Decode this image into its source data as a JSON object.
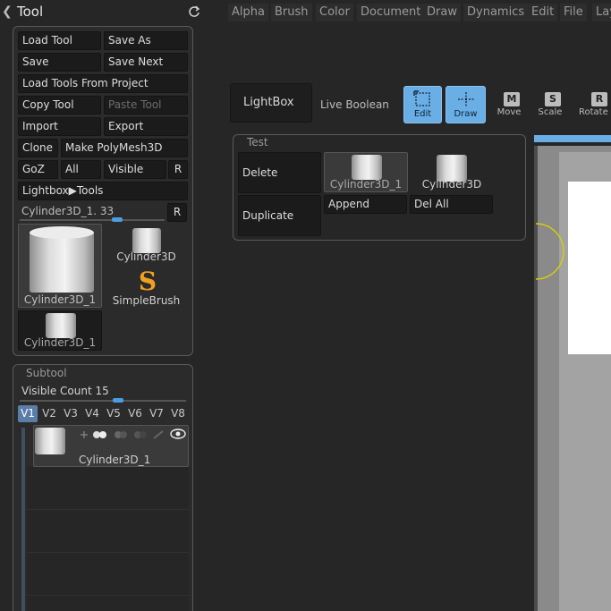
{
  "tool_panel": {
    "title": "Tool",
    "buttons": {
      "load_tool": "Load Tool",
      "save_as": "Save As",
      "save": "Save",
      "save_next": "Save Next",
      "load_tools_from_project": "Load Tools From Project",
      "copy_tool": "Copy Tool",
      "paste_tool": "Paste Tool",
      "import": "Import",
      "export": "Export",
      "clone": "Clone",
      "make_polymesh": "Make PolyMesh3D",
      "goz": "GoZ",
      "all": "All",
      "visible": "Visible",
      "r": "R",
      "lightbox_tools": "Lightbox▶Tools"
    },
    "slider": {
      "label": "Cylinder3D_1. 33",
      "r": "R",
      "value_fraction": 0.33
    },
    "thumbnails": {
      "main": "Cylinder3D_1",
      "cylinder3d": "Cylinder3D",
      "simplebrush": "SimpleBrush",
      "small": "Cylinder3D_1",
      "simplebrush_glyph": "S"
    }
  },
  "subtool_panel": {
    "title": "Subtool",
    "visible_count_label": "Visible Count 15",
    "visible_count_value": 15,
    "tabs": [
      "V1",
      "V2",
      "V3",
      "V4",
      "V5",
      "V6",
      "V7",
      "V8"
    ],
    "selected_tab": "V1",
    "item_name": "Cylinder3D_1"
  },
  "menu": [
    "Alpha",
    "Brush",
    "Color",
    "Document",
    "Draw",
    "Dynamics",
    "Edit",
    "File",
    "Lay"
  ],
  "toolbar": {
    "lightbox": "LightBox",
    "live_boolean": "Live Boolean",
    "edit": "Edit",
    "draw": "Draw",
    "move": "Move",
    "scale": "Scale",
    "rotate": "Rotate",
    "move_key": "M",
    "scale_key": "S",
    "rotate_key": "R"
  },
  "test_panel": {
    "title": "Test",
    "delete": "Delete",
    "duplicate": "Duplicate",
    "append": "Append",
    "del_all": "Del All",
    "thumb1": "Cylinder3D_1",
    "thumb2": "Cylinder3D"
  },
  "colors": {
    "accent": "#6aaee6",
    "panel": "#2b2b2b",
    "button": "#1b1b1b",
    "gizmo": "#d8d000"
  },
  "icons": [
    "back-arrow-icon",
    "refresh-icon",
    "edit-icon",
    "draw-icon",
    "move-icon",
    "scale-icon",
    "rotate-icon",
    "eye-icon"
  ]
}
